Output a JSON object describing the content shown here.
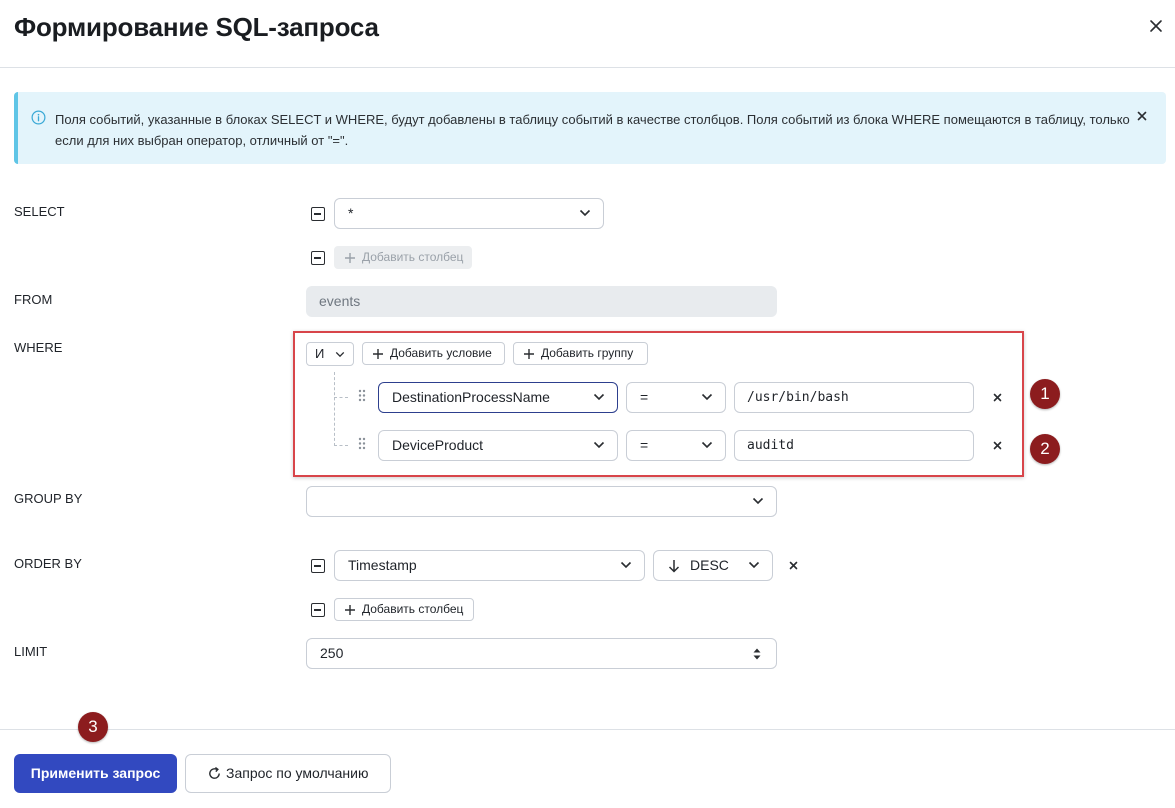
{
  "header": {
    "title": "Формирование SQL-запроса"
  },
  "banner": {
    "text": "Поля событий, указанные в блоках SELECT и WHERE, будут добавлены в таблицу событий в качестве столбцов. Поля событий из блока WHERE помещаются в таблицу, только если для них выбран оператор, отличный от \"=\"."
  },
  "select": {
    "label": "SELECT",
    "value": "*",
    "add_column": "Добавить столбец"
  },
  "from": {
    "label": "FROM",
    "value": "events"
  },
  "where": {
    "label": "WHERE",
    "logic_value": "И",
    "add_condition": "Добавить условие",
    "add_group": "Добавить группу",
    "conditions": [
      {
        "field": "DestinationProcessName",
        "operator": "=",
        "value": "/usr/bin/bash"
      },
      {
        "field": "DeviceProduct",
        "operator": "=",
        "value": "auditd"
      }
    ]
  },
  "group_by": {
    "label": "GROUP BY",
    "value": ""
  },
  "order_by": {
    "label": "ORDER BY",
    "field": "Timestamp",
    "direction": "DESC",
    "add_column": "Добавить столбец"
  },
  "limit": {
    "label": "LIMIT",
    "value": "250"
  },
  "footer": {
    "apply": "Применить запрос",
    "default": "Запрос по умолчанию"
  },
  "callouts": [
    "1",
    "2",
    "3"
  ],
  "colors": {
    "primary": "#3249c0",
    "banner_bg": "#e3f4fb",
    "banner_accent": "#5fc5e6",
    "highlight": "#d8454a",
    "badge": "#8c1c1e"
  }
}
